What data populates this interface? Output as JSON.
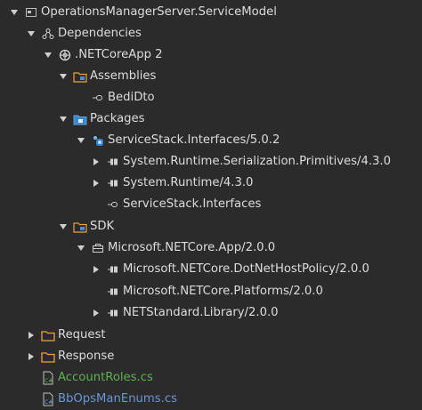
{
  "tree": {
    "root": {
      "label": "OperationsManagerServer.ServiceModel",
      "icon": "project-icon"
    },
    "dependencies": {
      "label": "Dependencies",
      "icon": "dependencies-icon"
    },
    "netcoreapp": {
      "label": ".NETCoreApp 2",
      "icon": "framework-icon"
    },
    "assemblies": {
      "label": "Assemblies",
      "icon": "assemblies-folder-icon"
    },
    "bedidto": {
      "label": "BediDto",
      "icon": "reference-icon"
    },
    "packages": {
      "label": "Packages",
      "icon": "packages-folder-icon"
    },
    "servicestack_interfaces_pkg": {
      "label": "ServiceStack.Interfaces/5.0.2",
      "icon": "nuget-package-icon"
    },
    "sys_runtime_serialization": {
      "label": "System.Runtime.Serialization.Primitives/4.3.0",
      "icon": "package-reference-icon"
    },
    "sys_runtime": {
      "label": "System.Runtime/4.3.0",
      "icon": "package-reference-icon"
    },
    "servicestack_interfaces_asm": {
      "label": "ServiceStack.Interfaces",
      "icon": "reference-icon"
    },
    "sdk": {
      "label": "SDK",
      "icon": "sdk-folder-icon"
    },
    "ms_netcore_app": {
      "label": "Microsoft.NETCore.App/2.0.0",
      "icon": "sdk-package-icon"
    },
    "ms_dotnethostpolicy": {
      "label": "Microsoft.NETCore.DotNetHostPolicy/2.0.0",
      "icon": "package-reference-icon"
    },
    "ms_platforms": {
      "label": "Microsoft.NETCore.Platforms/2.0.0",
      "icon": "package-reference-icon"
    },
    "netstandard_library": {
      "label": "NETStandard.Library/2.0.0",
      "icon": "package-reference-icon"
    },
    "request": {
      "label": "Request",
      "icon": "folder-icon"
    },
    "response": {
      "label": "Response",
      "icon": "folder-icon"
    },
    "accountroles": {
      "label": "AccountRoles.cs",
      "icon": "csharp-file-icon"
    },
    "bbopsmanenums": {
      "label": "BbOpsManEnums.cs",
      "icon": "csharp-file-icon"
    }
  },
  "colors": {
    "background": "#2b2b2b",
    "text": "#dcdcdc",
    "cs_file_green": "#5eb14f",
    "cs_file_blue": "#6a96d6",
    "folder_orange": "#e8a33d"
  }
}
